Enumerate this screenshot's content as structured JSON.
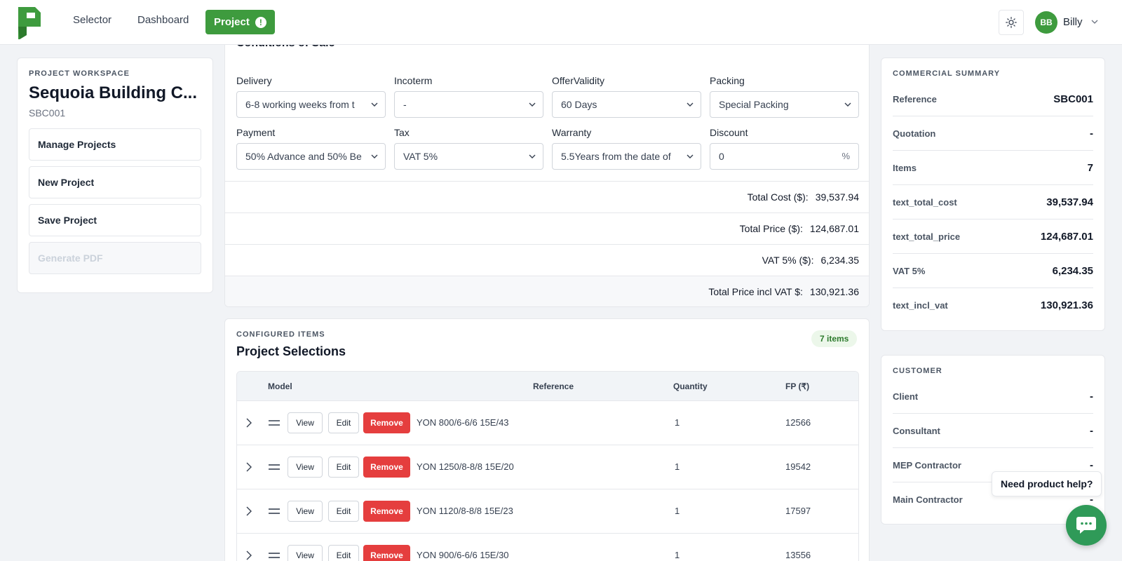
{
  "nav": {
    "links": [
      "Selector",
      "Dashboard"
    ],
    "active": "Project",
    "alert_glyph": "!",
    "user_initials": "BB",
    "user_name": "Billy",
    "accent_color": "#3e9b3e"
  },
  "workspace": {
    "eyebrow": "PROJECT WORKSPACE",
    "title": "Sequoia Building C...",
    "code": "SBC001",
    "buttons": [
      "Manage Projects",
      "New Project",
      "Save Project",
      "Generate PDF"
    ]
  },
  "conditions": {
    "title": "Conditions of Sale",
    "fields": [
      {
        "label": "Delivery",
        "value": "6-8 working weeks from t"
      },
      {
        "label": "Incoterm",
        "value": "-"
      },
      {
        "label": "OfferValidity",
        "value": "60 Days"
      },
      {
        "label": "Packing",
        "value": "Special Packing"
      },
      {
        "label": "Payment",
        "value": "50% Advance and 50% Be"
      },
      {
        "label": "Tax",
        "value": "VAT 5%"
      },
      {
        "label": "Warranty",
        "value": "5.5Years from the date of"
      },
      {
        "label": "Discount",
        "value": "0",
        "suffix": "%"
      }
    ],
    "totals": [
      {
        "label": "Total Cost ($):",
        "value": "39,537.94"
      },
      {
        "label": "Total Price ($):",
        "value": "124,687.01"
      },
      {
        "label": "VAT 5% ($):",
        "value": "6,234.35"
      },
      {
        "label": "Total Price incl VAT $:",
        "value": "130,921.36"
      }
    ]
  },
  "items": {
    "eyebrow": "CONFIGURED ITEMS",
    "title": "Project Selections",
    "badge": "7 items",
    "headers": [
      "Model",
      "Reference",
      "Quantity",
      "FP (₹)"
    ],
    "button_labels": {
      "view": "View",
      "edit": "Edit",
      "remove": "Remove"
    },
    "rows": [
      {
        "model": "YON 800/6-6/6 15E/43",
        "quantity": "1",
        "fp": "12566"
      },
      {
        "model": "YON 1250/8-8/8 15E/20",
        "quantity": "1",
        "fp": "19542"
      },
      {
        "model": "YON 1120/8-8/8 15E/23",
        "quantity": "1",
        "fp": "17597"
      },
      {
        "model": "YON 900/6-6/6 15E/30",
        "quantity": "1",
        "fp": "13556"
      }
    ]
  },
  "summary": {
    "eyebrow": "COMMERCIAL SUMMARY",
    "rows": [
      {
        "k": "Reference",
        "v": "SBC001"
      },
      {
        "k": "Quotation",
        "v": "-"
      },
      {
        "k": "Items",
        "v": "7"
      },
      {
        "k": "text_total_cost",
        "v": "39,537.94"
      },
      {
        "k": "text_total_price",
        "v": "124,687.01"
      },
      {
        "k": "VAT 5%",
        "v": "6,234.35"
      },
      {
        "k": "text_incl_vat",
        "v": "130,921.36"
      }
    ]
  },
  "customer": {
    "eyebrow": "CUSTOMER",
    "rows": [
      {
        "k": "Client",
        "v": "-"
      },
      {
        "k": "Consultant",
        "v": "-"
      },
      {
        "k": "MEP Contractor",
        "v": "-"
      },
      {
        "k": "Main Contractor",
        "v": "-"
      }
    ]
  },
  "help": {
    "text": "Need product help?"
  },
  "colors": {
    "danger": "#e53e3e",
    "chat": "#2f9a58"
  }
}
